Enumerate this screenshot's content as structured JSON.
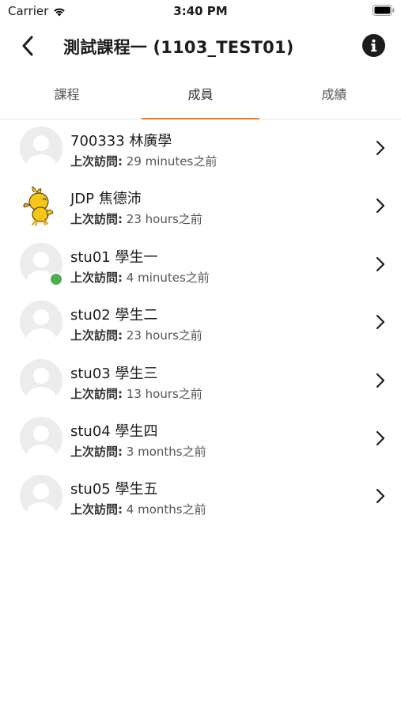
{
  "status_bar": {
    "carrier": "Carrier",
    "time": "3:40 PM"
  },
  "nav": {
    "title": "測試課程一 (1103_TEST01)"
  },
  "tabs": [
    {
      "label": "課程",
      "active": false
    },
    {
      "label": "成員",
      "active": true
    },
    {
      "label": "成績",
      "active": false
    }
  ],
  "visit_label": "上次訪問:",
  "members": [
    {
      "name": "700333 林廣學",
      "last_visit": "29 minutes之前",
      "online": false,
      "avatar": "default"
    },
    {
      "name": "JDP 焦德沛",
      "last_visit": "23 hours之前",
      "online": false,
      "avatar": "woodstock"
    },
    {
      "name": "stu01 學生一",
      "last_visit": "4 minutes之前",
      "online": true,
      "avatar": "default"
    },
    {
      "name": "stu02 學生二",
      "last_visit": "23 hours之前",
      "online": false,
      "avatar": "default"
    },
    {
      "name": "stu03 學生三",
      "last_visit": "13 hours之前",
      "online": false,
      "avatar": "default"
    },
    {
      "name": "stu04 學生四",
      "last_visit": "3 months之前",
      "online": false,
      "avatar": "default"
    },
    {
      "name": "stu05 學生五",
      "last_visit": "4 months之前",
      "online": false,
      "avatar": "default"
    }
  ],
  "colors": {
    "accent": "#f47a20",
    "online": "#4caf50"
  }
}
